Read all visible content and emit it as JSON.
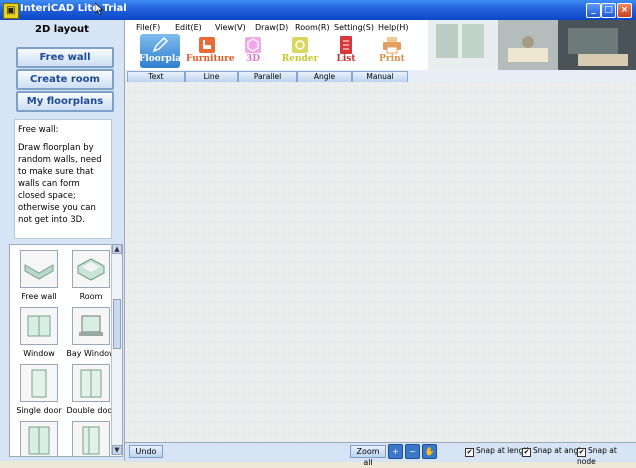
{
  "window": {
    "title": "InteriCAD Lite Trial",
    "minimize": "_",
    "maximize": "□",
    "close": "×"
  },
  "sidebar": {
    "heading": "2D layout",
    "buttons": [
      "Free wall",
      "Create room",
      "My floorplans"
    ],
    "help_title": "Free wall:",
    "help_text": "Draw floorplan by random walls, need to make sure that walls can form closed space; otherwise you can not get into 3D."
  },
  "palette": {
    "items": [
      {
        "label": "Free wall",
        "icon": "free-wall-icon"
      },
      {
        "label": "Room",
        "icon": "room-icon"
      },
      {
        "label": "Window",
        "icon": "window-icon"
      },
      {
        "label": "Bay Window",
        "icon": "bay-window-icon"
      },
      {
        "label": "Single door",
        "icon": "single-door-icon"
      },
      {
        "label": "Double door",
        "icon": "double-door-icon"
      }
    ]
  },
  "menu": {
    "items": [
      "File(F)",
      "Edit(E)",
      "View(V)",
      "Draw(D)",
      "Room(R)",
      "Setting(S)",
      "Help(H)"
    ]
  },
  "toolbar": {
    "tools": [
      {
        "label": "Floorplan",
        "color": "#ffffff"
      },
      {
        "label": "Furniture",
        "color": "#e05a28"
      },
      {
        "label": "3D",
        "color": "#e05ad0"
      },
      {
        "label": "Render",
        "color": "#c8c832"
      },
      {
        "label": "List",
        "color": "#c83030"
      },
      {
        "label": "Print",
        "color": "#d89048"
      }
    ]
  },
  "dimension_tabs": [
    "Text",
    "Line Dimension",
    "Parallel Dimension",
    "Angle Dimension",
    "Manual Distance"
  ],
  "bottom": {
    "undo": "Undo",
    "zoom_all": "Zoom all",
    "zoom_in": "+",
    "zoom_out": "−",
    "pan": "✋",
    "snaps": [
      {
        "label": "Snap at length",
        "checked": true
      },
      {
        "label": "Snap at angle",
        "checked": true
      },
      {
        "label": "Snap at node",
        "checked": true
      }
    ]
  }
}
